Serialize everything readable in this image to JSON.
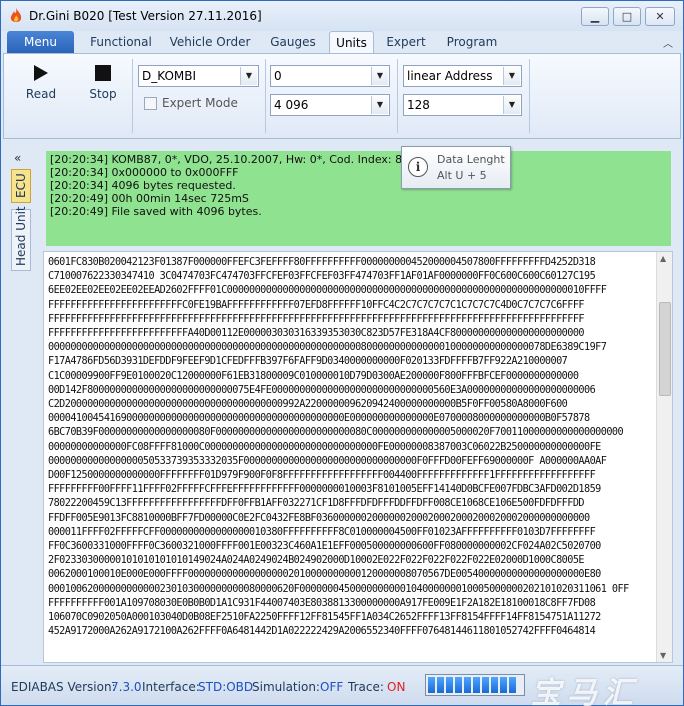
{
  "window": {
    "title": "Dr.Gini B020 [Test Version 27.11.2016]",
    "controls": {
      "minimize": "▁",
      "maximize": "□",
      "close": "✕"
    }
  },
  "tabs": [
    {
      "label": "Menu"
    },
    {
      "label": "Functional"
    },
    {
      "label": "Vehicle Order"
    },
    {
      "label": "Gauges"
    },
    {
      "label": "Units"
    },
    {
      "label": "Expert"
    },
    {
      "label": "Program"
    }
  ],
  "active_tab": "Units",
  "ribbon": {
    "read_label": "Read",
    "stop_label": "Stop",
    "ecu_combo": "D_KOMBI",
    "expert_mode_label": "Expert Mode",
    "expert_mode_checked": false,
    "start_combo": "0",
    "length_combo": "4 096",
    "address_combo": "linear Address",
    "block_combo": "128"
  },
  "side_tabs": {
    "ecu": "ECU",
    "head_unit": "Head Unit"
  },
  "tooltip": {
    "title": "Data Lenght",
    "shortcut": "Alt U + 5",
    "icon": "i"
  },
  "log": [
    "[20:20:34] KOMB87, 0*, VDO, 25.10.2007, Hw: 0*, Cod. Index: 8",
    "[20:20:34] 0x000000 to 0x000FFF",
    "[20:20:34] 4096 bytes requested.",
    "[20:20:49] 00h  00min  14sec  725mS",
    "[20:20:49] File saved with 4096 bytes."
  ],
  "hex_lines": [
    "0601FC830B020042123F01387F000000FFEFC3FEFFFF80FFFFFFFFFF000000000452000004507800FFFFFFFFFD4252D318",
    "C710007622330347410 3C0474703FC474703FFCFEF03FFCFEF03FF474703FF1AF01AF0000000FF0C600C600C60127C195",
    "6EE02EE02EE02EE02EEAD2602FFFF01C0000000000000000000000000000000000000000000000000000000000000010FFFF",
    "FFFFFFFFFFFFFFFFFFFFFFFFC0FE19BAFFFFFFFFFFFF07EFD8FFFFFF10FFC4C2C7C7C7C7C1C7C7C7C4D0C7C7C7C6FFFF",
    "FFFFFFFFFFFFFFFFFFFFFFFFFFFFFFFFFFFFFFFFFFFFFFFFFFFFFFFFFFFFFFFFFFFFFFFFFFFFFFFFFFFFFFFFFFFFFFFF",
    "FFFFFFFFFFFFFFFFFFFFFFFFFA40D00112E000003030316339353030C823D57FE318A4CF800000000000000000000000",
    "00000000000000000000000000000000000000000000000000000000800000000000000100000000000000078DE6389C19F7",
    "F17A4786FD56D3931DEFDDF9FEEF9D1CFEDFFFB397F6FAFF9D0340000000000F020133FDFFFFB7FF922A210000007",
    "C1C00009900FF9E0100020C12000000F61EB31800009C010000010D79D0300AE200000F800FFFBFCEF0000000000000",
    "00D142F80000000000000000000000000075E4FE00000000000000000000000000000560E3A00000000000000000000006",
    "C2D200000000000000000000000000000000000000992A220000009620942400000000000B5F0FF00580A8000F600",
    "00004100454169000000000000000000000000000000000000000E000000000000000E0700008000000000000B0F57878",
    "6BC70B39F00000000000000000080F000000000000000000000000080C000000000000005000020F70011000000000000000000",
    "00000000000000FC08FFFF81000C0000000000000000000000000000000FE00000008387003C06022B250000000000000FE",
    "0000000000000000050533739353332035F0000000000000000000000000000000F0FFFD00FEFF69000000F A000000AA0AF",
    "D00F1250000000000000FFFFFFFF01D979F900F0F8FFFFFFFFFFFFFFFFFF004400FFFFFFFFFFFFF1FFFFFFFFFFFFFFFFFF",
    "FFFFFFFFF00FFFF11FFFF02FFFFFCFFFEFFFFFFFFFFFF0000000010003F8101005EFF14140D0BCFE007FDBC3AFD002D1859",
    "78022200459C13FFFFFFFFFFFFFFFFFDFF0FFB1AFF032271CF1D8FFFDFDFFFDDFFDFF008CE1068CE106E500FDFDFFFDD",
    "FFDFF005E9013FC8810000BFF7FD00000C0E2FC0432FE8BF0360000002000000200020002000200020002000000000000",
    "000011FFFF02FFFFFCFF0000000000000000010380FFFFFFFFFF8C010000004500FF01023AFFFFFFFFFF0103D7FFFFFFFF",
    "FF0C3600331000FFFF0C3600321000FFFF001E00323C460A1E1EFF000500000000600FF080000000002CF024A02C5020700",
    "2F02330300000101010101010149024A024A0249024B024902000D10002E022F022F022F022F022E02000D1000C8005E",
    "0062000100010E000E000FFFF0000000000000000002010000000000120000008070567DE00540000000000000000000E80",
    "00010062000000000000230103000000000080000620F0000000450000000000104000000010005000000202101020311061 0FF",
    "FFFFFFFFFF001A109708030E0B0B0D1A1C931F44007403E8038813300000000A917FE009E1F2A182E18100018C8FF7FD08",
    "106070C0902050A000103040D0B08EF2510FA2250FFFF12FF81545FF1A034C2652FFFF13FF8154FFFF14FF8154751A11272",
    "452A9172000A262A9172100A262FFFF0A6481442D1A022222429A2006552340FFFF07648144611801052742FFFF0464814"
  ],
  "status": {
    "ediabas_label": "EDIABAS Version:",
    "ediabas_value": "7.3.0",
    "interface_label": "Interface:",
    "interface_value": "STD:OBD",
    "simulation_label": "Simulation:",
    "simulation_value": "OFF",
    "trace_label": "Trace:",
    "trace_value": "ON",
    "progress_fraction": 1.0,
    "watermark": "宝马汇"
  },
  "colors": {
    "log_background": "#8fe28f",
    "menu_tab": "#2a63b8",
    "status_blue": "#1f4fc0",
    "status_red": "#e02020",
    "ecu_tab": "#f8e28a"
  }
}
